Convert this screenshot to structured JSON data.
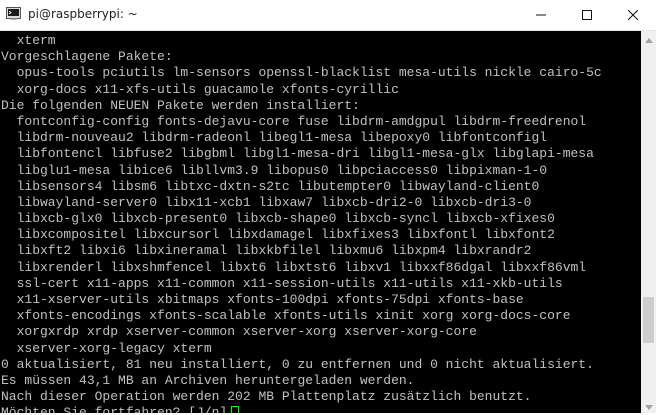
{
  "window": {
    "title": "pi@raspberrypi: ~",
    "icons": {
      "app": "putty-terminal-icon",
      "minimize": "minimize-icon",
      "maximize": "maximize-icon",
      "close": "close-icon"
    }
  },
  "terminal": {
    "lines": [
      "  xterm",
      "Vorgeschlagene Pakete:",
      "  opus-tools pciutils lm-sensors openssl-blacklist mesa-utils nickle cairo-5c",
      "  xorg-docs x11-xfs-utils guacamole xfonts-cyrillic",
      "Die folgenden NEUEN Pakete werden installiert:",
      "  fontconfig-config fonts-dejavu-core fuse libdrm-amdgpul libdrm-freedrenol",
      "  libdrm-nouveau2 libdrm-radeonl libegl1-mesa libepoxy0 libfontconfigl",
      "  libfontencl libfuse2 libgbml libgl1-mesa-dri libgl1-mesa-glx libglapi-mesa",
      "  libglu1-mesa libice6 libllvm3.9 libopus0 libpciaccess0 libpixman-1-0",
      "  libsensors4 libsm6 libtxc-dxtn-s2tc libutempter0 libwayland-client0",
      "  libwayland-server0 libx11-xcb1 libxaw7 libxcb-dri2-0 libxcb-dri3-0",
      "  libxcb-glx0 libxcb-present0 libxcb-shape0 libxcb-syncl libxcb-xfixes0",
      "  libxcompositel libxcursorl libxdamagel libxfixes3 libxfontl libxfont2",
      "  libxft2 libxi6 libxineramal libxkbfilel libxmu6 libxpm4 libxrandr2",
      "  libxrenderl libxshmfencel libxt6 libxtst6 libxv1 libxxf86dgal libxxf86vml",
      "  ssl-cert x11-apps x11-common x11-session-utils x11-utils x11-xkb-utils",
      "  x11-xserver-utils xbitmaps xfonts-100dpi xfonts-75dpi xfonts-base",
      "  xfonts-encodings xfonts-scalable xfonts-utils xinit xorg xorg-docs-core",
      "  xorgxrdp xrdp xserver-common xserver-xorg xserver-xorg-core",
      "  xserver-xorg-legacy xterm",
      "0 aktualisiert, 81 neu installiert, 0 zu entfernen und 0 nicht aktualisiert.",
      "Es müssen 43,1 MB an Archiven heruntergeladen werden.",
      "Nach dieser Operation werden 202 MB Plattenplatz zusätzlich benutzt."
    ],
    "prompt": "Möchten Sie fortfahren? [J/n]",
    "colors": {
      "background": "#000000",
      "text": "#c0c0c0",
      "cursor": "#00ff00"
    }
  },
  "scrollbar": {
    "position": 0.82,
    "icons": {
      "up": "scroll-up-arrow-icon",
      "down": "scroll-down-arrow-icon"
    }
  }
}
